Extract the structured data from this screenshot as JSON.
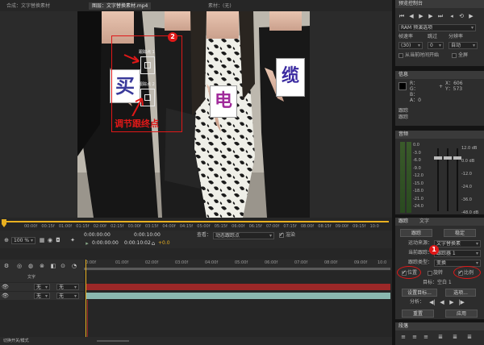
{
  "comp_tab": "合成：文字替换素材",
  "footage_tab": "图层：文字替换素材.mp4",
  "footage_tab_close": "≡",
  "material_tab": "素材：(无)",
  "card_text": {
    "left": "买",
    "middle": "电",
    "right": "缆"
  },
  "track_points": {
    "point1": "跟踪点 1",
    "point2": "跟踪点 2"
  },
  "annotation": {
    "num1": "1",
    "num2": "2",
    "adjust_label": "调节跟终点"
  },
  "viewer": {
    "time_ruler": [
      "00:00f",
      "00:15f",
      "01:00f",
      "01:15f",
      "02:00f",
      "02:15f",
      "03:00f",
      "03:15f",
      "04:00f",
      "04:15f",
      "05:00f",
      "05:15f",
      "06:00f",
      "06:15f",
      "07:00f",
      "07:15f",
      "08:00f",
      "08:15f",
      "09:00f",
      "09:15f",
      "10:0"
    ],
    "zoom": "100 %",
    "time_current": "0:00:00:00",
    "time_end": "0:00:10:00",
    "time_duration": "0:00:10:02",
    "delta": "+0.0",
    "view_label": "查看：",
    "view_value": "动态跟踪点",
    "render_label": "渲染"
  },
  "timeline": {
    "ruler": [
      "0:00f",
      "01:00f",
      "02:00f",
      "03:00f",
      "04:00f",
      "05:00f",
      "06:00f",
      "07:00f",
      "08:00f",
      "09:00f",
      "10:0"
    ],
    "layer1_mode": "无",
    "layer2_mode": "无",
    "text_tab": "文字",
    "footer": "切换开关/模式"
  },
  "preview_panel": {
    "title": "预览控制台",
    "ram_preview": "RAM 预演选项",
    "fps_label": "帧速率",
    "skip_label": "跳过",
    "res_label": "分辨率",
    "fps_value": "(30)",
    "skip_value": "0",
    "res_value": "自动",
    "from_current": "从当前时间开始",
    "fullscreen": "全屏"
  },
  "info_panel": {
    "title": "信息",
    "r": "R：",
    "g": "G：",
    "b": "B：",
    "a": "A：0",
    "x": "X：606",
    "y": "Y：573",
    "line1": "跟踪",
    "line2": "跟踪"
  },
  "audio_panel": {
    "title": "音频",
    "left_scale": [
      "0.0",
      "-3.0",
      "-6.0",
      "-9.0",
      "-12.0",
      "-15.0",
      "-18.0",
      "-21.0",
      "-24.0"
    ],
    "right_scale": [
      "12.0 dB",
      "0.0 dB",
      "-12.0",
      "-24.0",
      "-36.0",
      "-48.0 dB"
    ]
  },
  "tracker_panel": {
    "tab_tracker": "跟踪",
    "tab_text": "文字",
    "btn_track": "跟踪",
    "btn_stabilize": "稳定",
    "motion_source_label": "运动来源：",
    "motion_source_value": "文字替换素",
    "current_track_label": "当前跟踪：",
    "current_track_value": "跟踪器 1",
    "track_type_label": "跟踪类型：",
    "track_type_value": "变换",
    "position": "位置",
    "rotation": "旋转",
    "scale": "比例",
    "target_label": "目标：空白 1",
    "set_target": "设置目标...",
    "options": "选项...",
    "analyze_label": "分析：",
    "reset": "重置",
    "apply": "应用"
  },
  "paragraph_panel": {
    "title": "段落"
  },
  "colors": {
    "accent": "#e8b020",
    "annotation_red": "#e01818",
    "timeline_bar": "#9c2828",
    "timeline_bar2": "#8ab8b0"
  }
}
